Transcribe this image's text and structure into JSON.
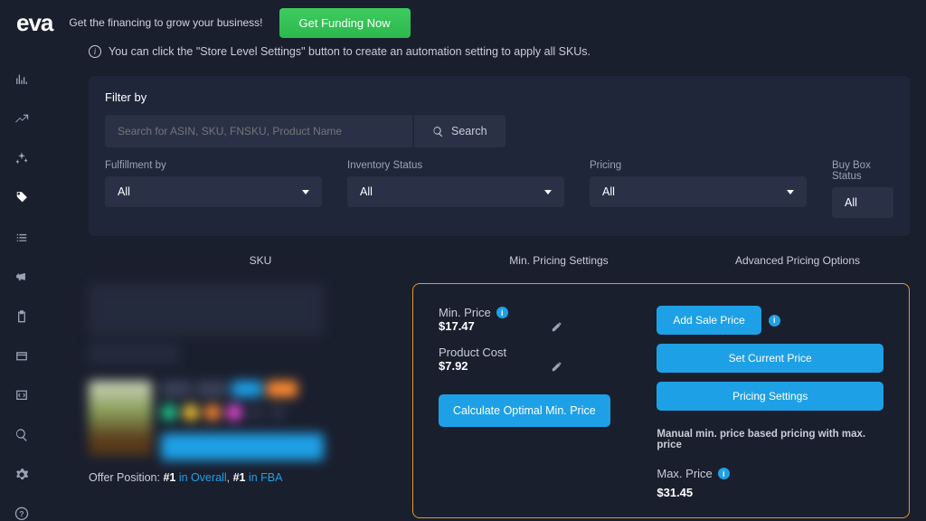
{
  "top": {
    "logo": "eva",
    "funding_text": "Get the financing to grow your business!",
    "funding_btn": "Get Funding Now"
  },
  "info_bar": "You can click the \"Store Level Settings\" button to create an automation setting to apply all SKUs.",
  "filter": {
    "title": "Filter by",
    "search_placeholder": "Search for ASIN, SKU, FNSKU, Product Name",
    "search_btn": "Search",
    "fulfillment_label": "Fulfillment by",
    "fulfillment_value": "All",
    "inventory_label": "Inventory Status",
    "inventory_value": "All",
    "pricing_label": "Pricing",
    "pricing_value": "All",
    "buybox_label": "Buy Box Status",
    "buybox_value": "All"
  },
  "columns": {
    "sku": "SKU",
    "min_pricing": "Min. Pricing Settings",
    "advanced": "Advanced Pricing Options"
  },
  "offer": {
    "prefix": "Offer Position: ",
    "rank1": "#1",
    "in1": " in Overall",
    "sep": ", ",
    "rank2": "#1",
    "in2": " in FBA"
  },
  "pricing": {
    "min_price_label": "Min. Price",
    "min_price_value": "$17.47",
    "product_cost_label": "Product Cost",
    "product_cost_value": "$7.92",
    "calc_btn": "Calculate Optimal Min. Price",
    "add_sale": "Add Sale Price",
    "set_current": "Set Current Price",
    "settings": "Pricing Settings",
    "note": "Manual min. price based pricing with max. price",
    "max_price_label": "Max. Price",
    "max_price_value": "$31.45"
  }
}
